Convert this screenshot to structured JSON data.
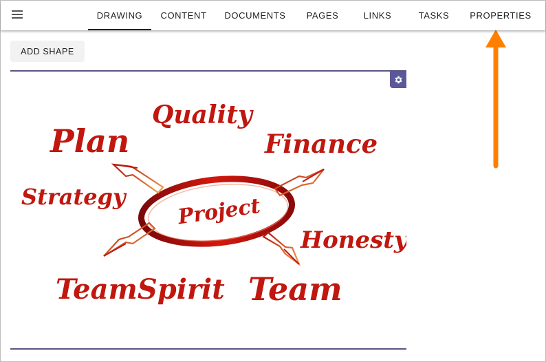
{
  "topbar": {
    "menu_icon": "hamburger-menu-icon",
    "tabs": [
      {
        "label": "DRAWING",
        "active": true
      },
      {
        "label": "CONTENT",
        "active": false
      },
      {
        "label": "DOCUMENTS",
        "active": false
      },
      {
        "label": "PAGES",
        "active": false
      },
      {
        "label": "LINKS",
        "active": false
      },
      {
        "label": "TASKS",
        "active": false
      },
      {
        "label": "PROPERTIES",
        "active": false
      }
    ]
  },
  "toolbar": {
    "add_shape_label": "ADD SHAPE"
  },
  "canvas": {
    "settings_icon": "gear-icon",
    "image_words": {
      "center": "Project",
      "plan": "Plan",
      "quality": "Quality",
      "finance": "Finance",
      "strategy": "Strategy",
      "honesty": "Honesty",
      "teamspirit": "TeamSpirit",
      "team": "Team"
    }
  },
  "annotation": {
    "arrow_icon": "orange-up-arrow-icon",
    "color": "#ff8000"
  },
  "colors": {
    "accent": "#5b579b",
    "canvas_border": "#5a5485",
    "word_red": "#c0170f"
  }
}
